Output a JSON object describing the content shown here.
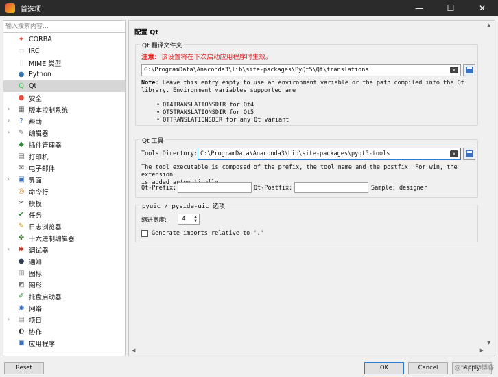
{
  "window": {
    "title": "首选项",
    "minimize": "—",
    "maximize": "☐",
    "close": "✕"
  },
  "sidebar": {
    "search_placeholder": "输入搜索内容…",
    "items": [
      {
        "label": "CORBA",
        "icon": "corba-icon",
        "color": "#e74c3c",
        "glyph": "✦",
        "arrow": ""
      },
      {
        "label": "IRC",
        "icon": "irc-icon",
        "color": "#d0d0d0",
        "glyph": "▭",
        "arrow": ""
      },
      {
        "label": "MIME 类型",
        "icon": "mime-icon",
        "color": "#e8e8e8",
        "glyph": "▯",
        "arrow": ""
      },
      {
        "label": "Python",
        "icon": "python-icon",
        "color": "#3776ab",
        "glyph": "●",
        "arrow": ""
      },
      {
        "label": "Qt",
        "icon": "qt-icon",
        "color": "#41cd52",
        "glyph": "Q",
        "arrow": ""
      },
      {
        "label": "安全",
        "icon": "security-icon",
        "color": "#e74c3c",
        "glyph": "●",
        "arrow": ""
      },
      {
        "label": "版本控制系统",
        "icon": "vcs-icon",
        "color": "#555555",
        "glyph": "▦",
        "arrow": "›"
      },
      {
        "label": "帮助",
        "icon": "help-icon",
        "color": "#3a6fc2",
        "glyph": "?",
        "arrow": "›"
      },
      {
        "label": "编辑器",
        "icon": "editor-icon",
        "color": "#777777",
        "glyph": "✎",
        "arrow": "›"
      },
      {
        "label": "插件管理器",
        "icon": "plugin-icon",
        "color": "#2e8b3a",
        "glyph": "◆",
        "arrow": ""
      },
      {
        "label": "打印机",
        "icon": "printer-icon",
        "color": "#666666",
        "glyph": "▤",
        "arrow": ""
      },
      {
        "label": "电子邮件",
        "icon": "email-icon",
        "color": "#555555",
        "glyph": "✉",
        "arrow": ""
      },
      {
        "label": "界面",
        "icon": "interface-icon",
        "color": "#3a6fc2",
        "glyph": "▣",
        "arrow": "›"
      },
      {
        "label": "命令行",
        "icon": "shell-icon",
        "color": "#d08020",
        "glyph": "◎",
        "arrow": ""
      },
      {
        "label": "模板",
        "icon": "template-icon",
        "color": "#555555",
        "glyph": "✂",
        "arrow": ""
      },
      {
        "label": "任务",
        "icon": "task-icon",
        "color": "#2e8b3a",
        "glyph": "✔",
        "arrow": ""
      },
      {
        "label": "日志浏览器",
        "icon": "log-icon",
        "color": "#d0a020",
        "glyph": "✎",
        "arrow": ""
      },
      {
        "label": "十六进制编辑器",
        "icon": "hex-icon",
        "color": "#4a7a3a",
        "glyph": "✤",
        "arrow": ""
      },
      {
        "label": "调试器",
        "icon": "debugger-icon",
        "color": "#c0392b",
        "glyph": "✱",
        "arrow": "›"
      },
      {
        "label": "通知",
        "icon": "notification-icon",
        "color": "#2c3e50",
        "glyph": "●",
        "arrow": ""
      },
      {
        "label": "图标",
        "icon": "icons-icon",
        "color": "#777777",
        "glyph": "▥",
        "arrow": ""
      },
      {
        "label": "图形",
        "icon": "graphics-icon",
        "color": "#777777",
        "glyph": "◩",
        "arrow": ""
      },
      {
        "label": "托盘启动器",
        "icon": "tray-icon",
        "color": "#2e8b3a",
        "glyph": "✐",
        "arrow": ""
      },
      {
        "label": "网络",
        "icon": "network-icon",
        "color": "#3a6fc2",
        "glyph": "◉",
        "arrow": ""
      },
      {
        "label": "项目",
        "icon": "project-icon",
        "color": "#777777",
        "glyph": "▤",
        "arrow": "›"
      },
      {
        "label": "协作",
        "icon": "cooperation-icon",
        "color": "#333333",
        "glyph": "◐",
        "arrow": ""
      },
      {
        "label": "应用程序",
        "icon": "application-icon",
        "color": "#3a6fc2",
        "glyph": "▣",
        "arrow": ""
      }
    ]
  },
  "main": {
    "title": "配置 Qt",
    "translations": {
      "legend": "Qt 翻译文件夹",
      "note_label": "注意:",
      "note_text": "该设置将在下次启动应用程序时生效。",
      "path": "C:\\ProgramData\\Anaconda3\\lib\\site-packages\\PyQt5\\Qt\\translations",
      "note_bold": "Note",
      "note_body": ": Leave this entry empty to use an environment variable or the path compiled into the Qt",
      "note_line2": "library. Environment variables supported are",
      "env_vars": [
        "QT4TRANSLATIONSDIR for Qt4",
        "QT5TRANSLATIONSDIR for Qt5",
        "QTTRANSLATIONSDIR for any Qt variant"
      ]
    },
    "tools": {
      "legend": "Qt 工具",
      "dir_label": "Tools Directory:",
      "dir_value": "C:\\ProgramData\\Anaconda3\\Lib\\site-packages\\pyqt5-tools",
      "desc_line1": "The tool executable is composed of the prefix, the tool name and the postfix. For win, the extension",
      "desc_line2": "is added automatically.",
      "prefix_label": "Qt-Prefix:",
      "postfix_label": "Qt-Postfix:",
      "sample": "Sample: designer"
    },
    "pyuic": {
      "legend": "pyuic / pyside-uic 选项",
      "indent_label": "缩进宽度:",
      "indent_value": "4",
      "generate_label": "Generate imports relative to '.'"
    }
  },
  "buttons": {
    "reset": "Reset",
    "ok": "OK",
    "cancel": "Cancel",
    "apply": "Apply"
  },
  "watermark": "@51CTO博客"
}
